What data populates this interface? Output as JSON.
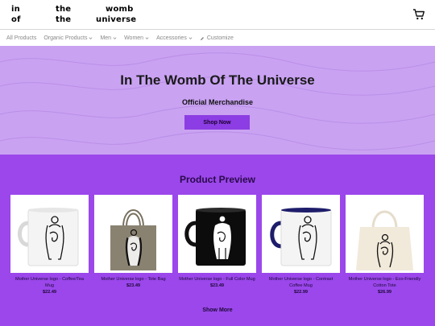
{
  "header": {
    "logo_words": [
      "in",
      "the",
      "womb",
      "of",
      "the",
      "universe"
    ],
    "cart_icon": "shopping-cart-icon"
  },
  "nav": {
    "items": [
      {
        "label": "All Products",
        "has_dropdown": false
      },
      {
        "label": "Organic Products",
        "has_dropdown": true
      },
      {
        "label": "Men",
        "has_dropdown": true
      },
      {
        "label": "Women",
        "has_dropdown": true
      },
      {
        "label": "Accessories",
        "has_dropdown": true
      },
      {
        "label": "Customize",
        "has_dropdown": false,
        "icon": "pencil-icon"
      }
    ]
  },
  "hero": {
    "title": "In The Womb Of The Universe",
    "subtitle": "Official Merchandise",
    "button_label": "Shop Now"
  },
  "products": {
    "title": "Product Preview",
    "show_more_label": "Show More",
    "items": [
      {
        "name": "Mother Universe logo - Coffee/Tea Mug",
        "price": "$22.49"
      },
      {
        "name": "Mother Universe logo - Tote Bag",
        "price": "$23.49"
      },
      {
        "name": "Mother Universe logo - Full Color Mug",
        "price": "$23.49"
      },
      {
        "name": "Mother Universe logo - Contrast Coffee Mug",
        "price": "$22.99"
      },
      {
        "name": "Mother Universe logo - Eco-Friendly Cotton Tote",
        "price": "$26.99"
      }
    ]
  },
  "colors": {
    "hero_bg": "#c9a2f2",
    "accent": "#8c3de3",
    "section_bg": "#9b47eb"
  }
}
